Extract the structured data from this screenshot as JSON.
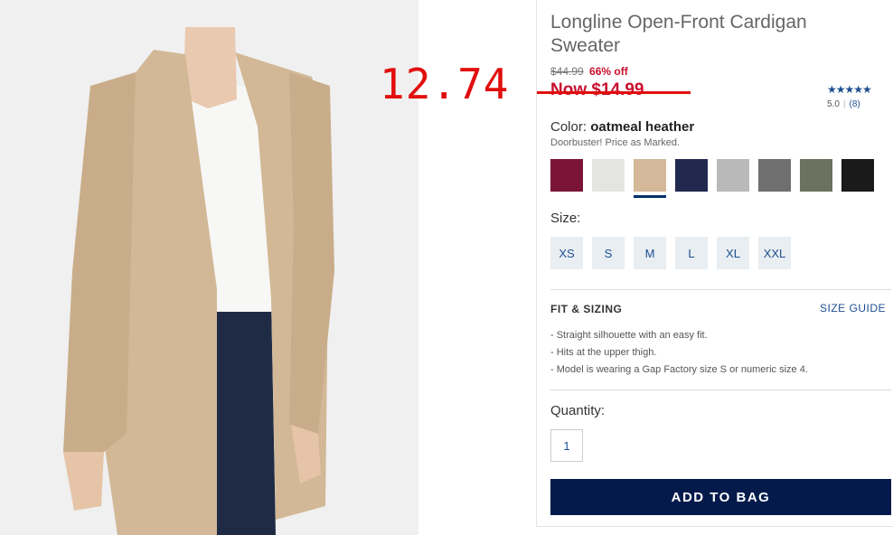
{
  "annotation": {
    "handwritten_price": "12.74"
  },
  "product": {
    "title": "Longline Open-Front Cardigan Sweater",
    "original_price": "$44.99",
    "percent_off": "66% off",
    "now_price": "Now $14.99",
    "rating": {
      "stars": "★★★★★",
      "score": "5.0",
      "count": "(8)"
    }
  },
  "color": {
    "label": "Color:",
    "selected": "oatmeal heather",
    "note": "Doorbuster! Price as Marked.",
    "swatches": [
      {
        "name": "burgundy",
        "hex": "#7a1437"
      },
      {
        "name": "light heather grey",
        "hex": "#e4e4e2"
      },
      {
        "name": "oatmeal heather",
        "hex": "#d4b899",
        "selected": true
      },
      {
        "name": "navy",
        "hex": "#22294f"
      },
      {
        "name": "light grey",
        "hex": "#b9b9b9"
      },
      {
        "name": "charcoal marl",
        "hex": "#6f6f6f"
      },
      {
        "name": "olive",
        "hex": "#6b7260"
      },
      {
        "name": "black",
        "hex": "#1a1a1a"
      }
    ]
  },
  "size": {
    "label": "Size:",
    "options": [
      "XS",
      "S",
      "M",
      "L",
      "XL",
      "XXL"
    ]
  },
  "fit": {
    "title": "FIT & SIZING",
    "guide_link": "SIZE GUIDE",
    "bullets": [
      "- Straight silhouette with an easy fit.",
      "- Hits at the upper thigh.",
      "- Model is wearing a Gap Factory size S or numeric size 4."
    ]
  },
  "quantity": {
    "label": "Quantity:",
    "value": "1"
  },
  "cta": {
    "add_to_bag": "ADD TO BAG"
  }
}
